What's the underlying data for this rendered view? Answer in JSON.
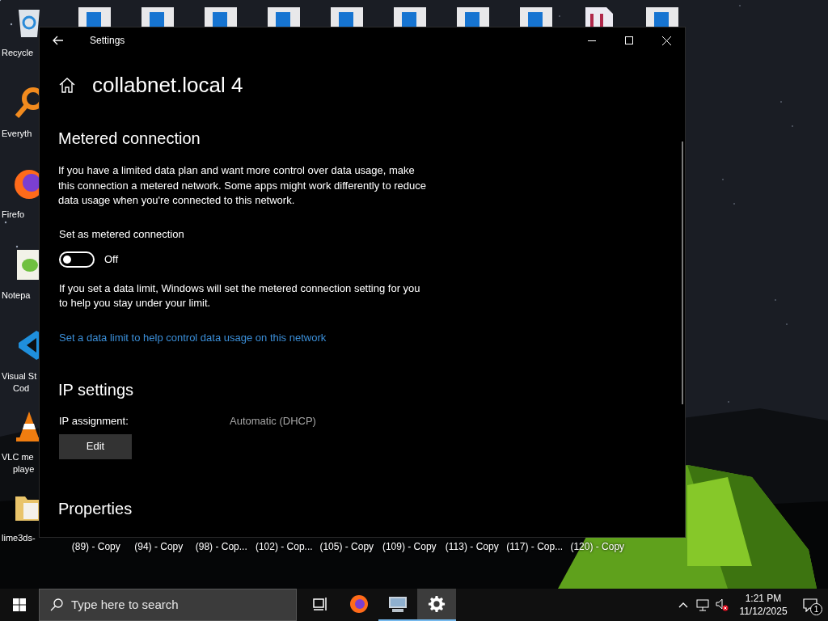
{
  "desktop": {
    "left_icons": [
      {
        "kind": "recycle-bin",
        "label": [
          "Recycle"
        ]
      },
      {
        "kind": "search-app",
        "label": [
          "Everyth"
        ]
      },
      {
        "kind": "firefox",
        "label": [
          "Firefo"
        ]
      },
      {
        "kind": "notepad",
        "label": [
          "Notepa"
        ]
      },
      {
        "kind": "code-editor",
        "label": [
          "Visual St",
          "Cod"
        ]
      },
      {
        "kind": "media-player",
        "label": [
          "VLC me",
          "playe"
        ]
      },
      {
        "kind": "folder",
        "label": [
          "lime3ds-"
        ]
      }
    ],
    "top_icons": [
      {
        "kind": "file"
      },
      {
        "kind": "file"
      },
      {
        "kind": "file"
      },
      {
        "kind": "file"
      },
      {
        "kind": "file"
      },
      {
        "kind": "file"
      },
      {
        "kind": "file"
      },
      {
        "kind": "file"
      },
      {
        "kind": "document"
      },
      {
        "kind": "file"
      }
    ],
    "bottom_labels": [
      "(89) - Copy",
      "(94) - Copy",
      "(98) - Cop...",
      "(102) - Cop...",
      "(105) - Copy",
      "(109) - Copy",
      "(113) - Copy",
      "(117) - Cop...",
      "(120) - Copy"
    ]
  },
  "window": {
    "title": "Settings",
    "page_title": "collabnet.local 4",
    "metered": {
      "heading": "Metered connection",
      "description": "If you have a limited data plan and want more control over data usage, make this connection a metered network. Some apps might work differently to reduce data usage when you're connected to this network.",
      "toggle_label": "Set as metered connection",
      "toggle": {
        "on": false,
        "state_text": "Off"
      },
      "note": "If you set a data limit, Windows will set the metered connection setting for you to help you stay under your limit.",
      "link": "Set a data limit to help control data usage on this network"
    },
    "ip_settings": {
      "heading": "IP settings",
      "label": "IP assignment:",
      "value": "Automatic (DHCP)",
      "button": "Edit"
    },
    "properties": {
      "heading": "Properties"
    }
  },
  "taskbar": {
    "search_placeholder": "Type here to search",
    "apps": [
      {
        "kind": "task-view",
        "running": false,
        "selected": false
      },
      {
        "kind": "firefox",
        "running": false,
        "selected": false
      },
      {
        "kind": "remote-desktop",
        "running": true,
        "selected": false
      },
      {
        "kind": "settings",
        "running": true,
        "selected": true
      }
    ],
    "time": "1:21 PM",
    "date": "11/12/2025",
    "notification_count": "1"
  }
}
